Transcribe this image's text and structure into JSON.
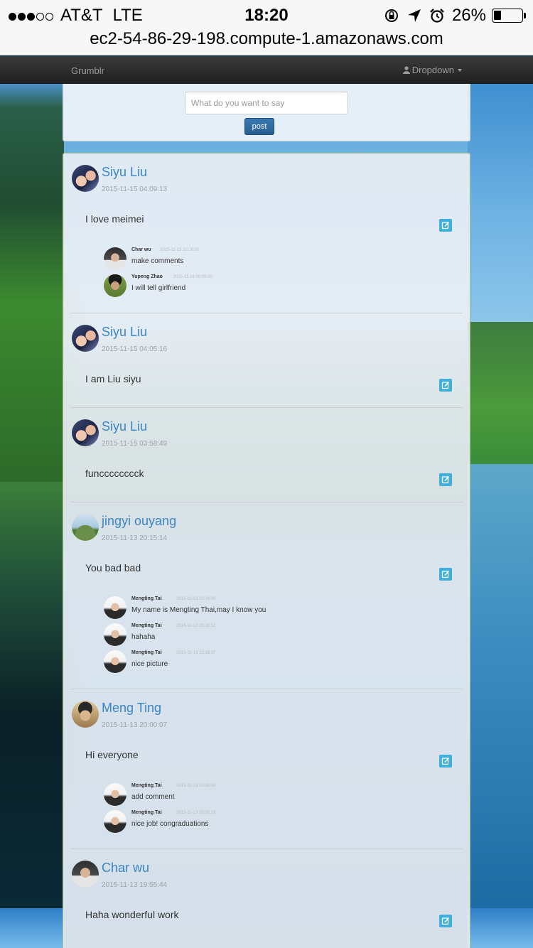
{
  "status_bar": {
    "carrier": "AT&T",
    "network": "LTE",
    "time": "18:20",
    "battery": "26%",
    "battery_level": 0.26,
    "signal_bars_filled": 3,
    "signal_bars_total": 5
  },
  "url_bar": {
    "url": "ec2-54-86-29-198.compute-1.amazonaws.com"
  },
  "navbar": {
    "brand": "Grumblr",
    "dropdown": "Dropdown"
  },
  "compose": {
    "placeholder": "What do you want to say",
    "post_label": "post"
  },
  "posts": [
    {
      "author": "Siyu Liu",
      "time": "2015-11-15 04:09:13",
      "text": "I love meimei",
      "comments": [
        {
          "author": "Char wu",
          "time": "2015-11-15 22:10:00",
          "text": "make comments"
        },
        {
          "author": "Yupeng Zhao",
          "time": "2015-11-16 00:09:00",
          "text": "I will tell girlfriend"
        }
      ]
    },
    {
      "author": "Siyu Liu",
      "time": "2015-11-15 04:05:16",
      "text": "I am Liu siyu",
      "comments": []
    },
    {
      "author": "Siyu Liu",
      "time": "2015-11-15 03:58:49",
      "text": "funcccccccck",
      "comments": []
    },
    {
      "author": "jingyi ouyang",
      "time": "2015-11-13 20:15:14",
      "text": "You bad bad",
      "comments": [
        {
          "author": "Mengting Tai",
          "time": "2015-11-13 20:16:00",
          "text": "My name is Mengting Thai,may I know you"
        },
        {
          "author": "Mengting Tai",
          "time": "2015-11-13 20:16:52",
          "text": "hahaha"
        },
        {
          "author": "Mengting Tai",
          "time": "2015-11-13 22:16:37",
          "text": "nice picture"
        }
      ]
    },
    {
      "author": "Meng Ting",
      "time": "2015-11-13 20:00:07",
      "text": "Hi everyone",
      "comments": [
        {
          "author": "Mengting Tai",
          "time": "2015-11-13 20:28:08",
          "text": "add comment"
        },
        {
          "author": "Mengting Tai",
          "time": "2015-11-13 20:30:16",
          "text": "nice job! congraduations"
        }
      ]
    },
    {
      "author": "Char wu",
      "time": "2015-11-13 19:55:44",
      "text": "Haha wonderful work",
      "comments": []
    }
  ],
  "colors": {
    "author_link": "#3a85c6",
    "navbar_bg": "#222222",
    "post_button": "#337ab7",
    "edit_icon": "#3fb0d9"
  },
  "icons": {
    "edit": "edit-icon",
    "user": "user-icon",
    "lock": "rotation-lock-icon",
    "location": "location-arrow-icon",
    "alarm": "alarm-icon"
  }
}
